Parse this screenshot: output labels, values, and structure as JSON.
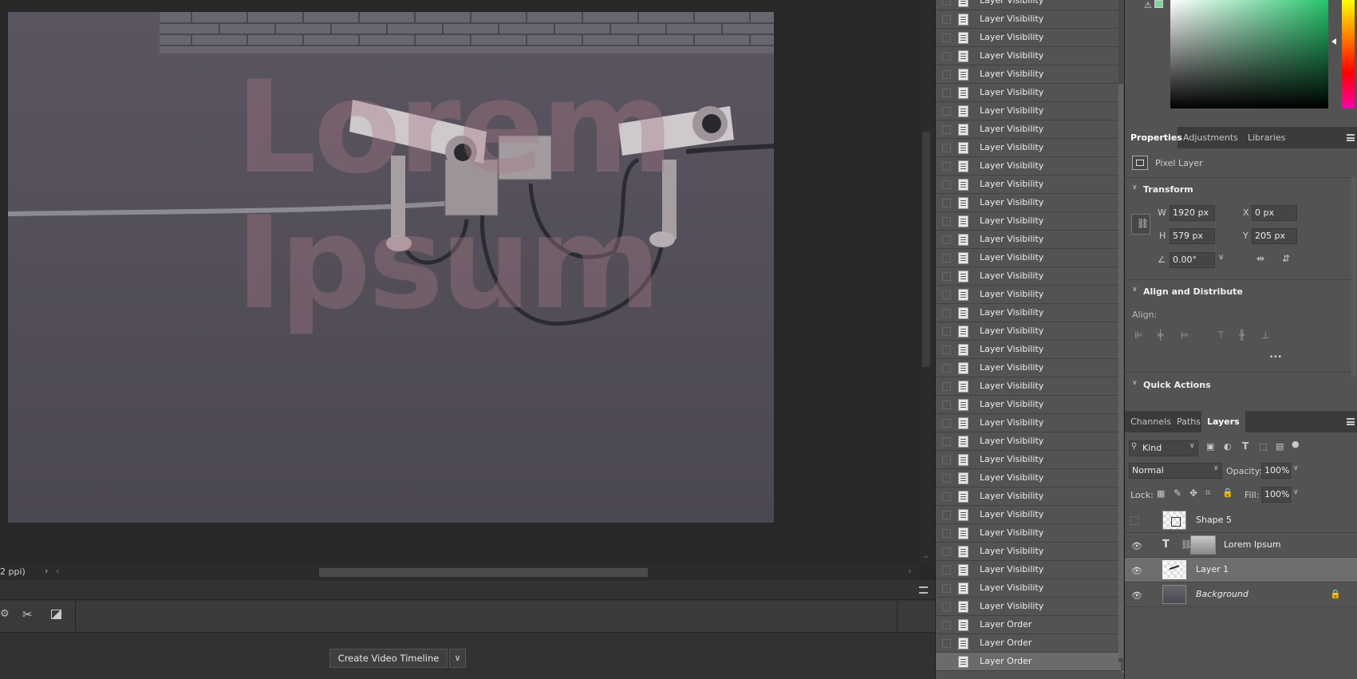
{
  "canvas": {
    "overlay_text_line1": "Lorem",
    "overlay_text_line2": "Ipsum",
    "zoom_status": "2 ppi)"
  },
  "timeline": {
    "create_button": "Create Video Timeline",
    "dropdown_arrow": "∨"
  },
  "history": {
    "items": [
      "Layer Visibility",
      "Layer Visibility",
      "Layer Visibility",
      "Layer Visibility",
      "Layer Visibility",
      "Layer Visibility",
      "Layer Visibility",
      "Layer Visibility",
      "Layer Visibility",
      "Layer Visibility",
      "Layer Visibility",
      "Layer Visibility",
      "Layer Visibility",
      "Layer Visibility",
      "Layer Visibility",
      "Layer Visibility",
      "Layer Visibility",
      "Layer Visibility",
      "Layer Visibility",
      "Layer Visibility",
      "Layer Visibility",
      "Layer Visibility",
      "Layer Visibility",
      "Layer Visibility",
      "Layer Visibility",
      "Layer Visibility",
      "Layer Visibility",
      "Layer Visibility",
      "Layer Visibility",
      "Layer Visibility",
      "Layer Visibility",
      "Layer Visibility",
      "Layer Visibility",
      "Layer Visibility",
      "Layer Order",
      "Layer Order",
      "Layer Order"
    ]
  },
  "properties": {
    "tabs": [
      "Properties",
      "Adjustments",
      "Libraries"
    ],
    "pixel_layer": "Pixel Layer",
    "transform_title": "Transform",
    "w_label": "W",
    "w_value": "1920 px",
    "x_label": "X",
    "x_value": "0 px",
    "h_label": "H",
    "h_value": "579 px",
    "y_label": "Y",
    "y_value": "205 px",
    "angle_value": "0.00°",
    "align_title": "Align and Distribute",
    "align_label": "Align:",
    "more": "•••",
    "quick_title": "Quick Actions"
  },
  "layers_panel": {
    "tabs": [
      "Channels",
      "Paths",
      "Layers"
    ],
    "kind": "Kind",
    "blend_mode": "Normal",
    "opacity_label": "Opacity:",
    "opacity_value": "100%",
    "lock_label": "Lock:",
    "fill_label": "Fill:",
    "fill_value": "100%",
    "layers": [
      {
        "name": "Shape 5"
      },
      {
        "name": "Lorem Ipsum"
      },
      {
        "name": "Layer 1"
      },
      {
        "name": "Background"
      }
    ]
  }
}
